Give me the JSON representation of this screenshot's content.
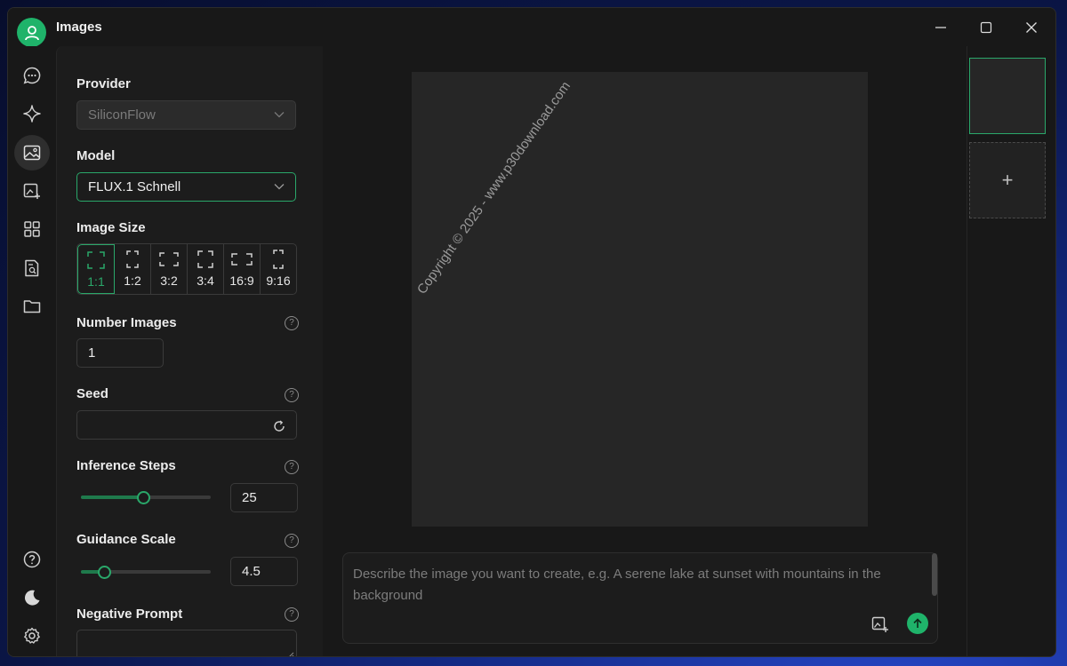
{
  "window": {
    "title": "Images",
    "controls": [
      "minimize",
      "maximize",
      "close"
    ]
  },
  "sidebar": {
    "items": [
      {
        "icon": "chat-icon"
      },
      {
        "icon": "sparkle-icon"
      },
      {
        "icon": "image-icon",
        "active": true
      },
      {
        "icon": "image-edit-icon"
      },
      {
        "icon": "apps-grid-icon"
      },
      {
        "icon": "document-search-icon"
      },
      {
        "icon": "folder-icon"
      }
    ],
    "bottom": [
      {
        "icon": "help-icon"
      },
      {
        "icon": "moon-icon"
      },
      {
        "icon": "gear-icon"
      }
    ]
  },
  "settings": {
    "provider_label": "Provider",
    "provider_value": "SiliconFlow",
    "model_label": "Model",
    "model_value": "FLUX.1 Schnell",
    "image_size_label": "Image Size",
    "sizes": [
      "1:1",
      "1:2",
      "3:2",
      "3:4",
      "16:9",
      "9:16"
    ],
    "selected_size": "1:1",
    "number_images_label": "Number Images",
    "number_images_value": "1",
    "seed_label": "Seed",
    "seed_value": "",
    "inference_steps_label": "Inference Steps",
    "inference_steps_value": "25",
    "inference_steps_fraction": 0.48,
    "guidance_scale_label": "Guidance Scale",
    "guidance_scale_value": "4.5",
    "guidance_scale_fraction": 0.18,
    "negative_prompt_label": "Negative Prompt",
    "help_glyph": "?"
  },
  "main": {
    "watermark": "Copyright © 2025 - www.p30download.com",
    "prompt_placeholder": "Describe the image you want to create, e.g. A serene lake at sunset with mountains in the background"
  },
  "thumbnails": {
    "add_glyph": "+"
  },
  "colors": {
    "accent": "#2aa86a",
    "window_bg": "#181818",
    "panel_bg": "#1c1c1c",
    "canvas_bg": "#262626"
  }
}
